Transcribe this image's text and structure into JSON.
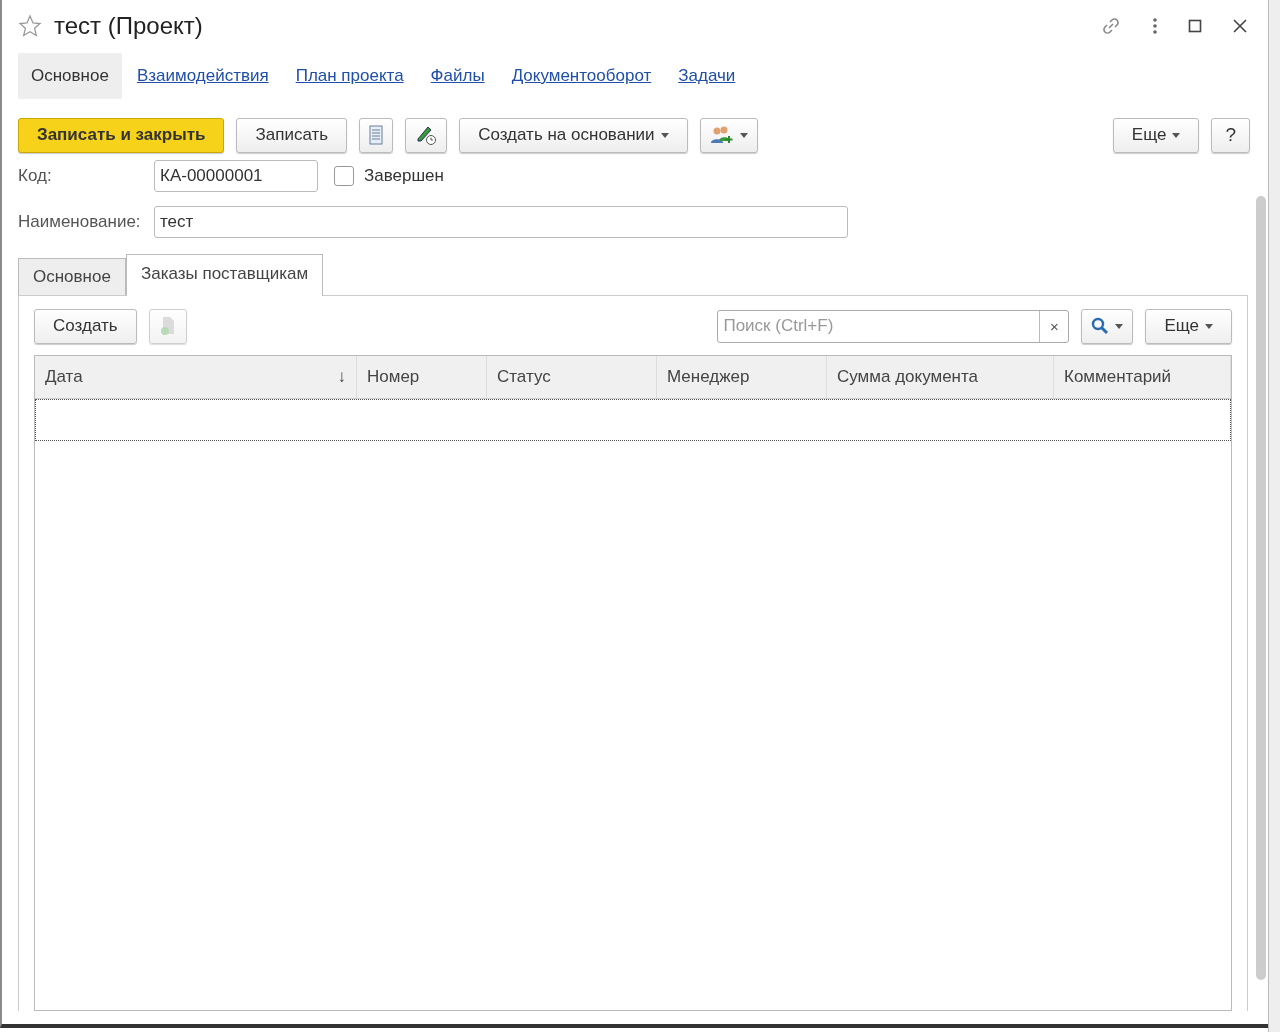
{
  "window": {
    "title": "тест (Проект)",
    "favorite": false
  },
  "nav_tabs": [
    {
      "label": "Основное",
      "selected": true
    },
    {
      "label": "Взаимодействия",
      "selected": false
    },
    {
      "label": "План проекта",
      "selected": false
    },
    {
      "label": "Файлы",
      "selected": false
    },
    {
      "label": "Документооборот",
      "selected": false
    },
    {
      "label": "Задачи",
      "selected": false
    }
  ],
  "toolbar": {
    "left": [
      {
        "kind": "primary",
        "label": "Записать и закрыть"
      },
      {
        "kind": "text",
        "label": "Записать"
      },
      {
        "kind": "list"
      },
      {
        "kind": "pen"
      },
      {
        "kind": "dropdown",
        "label": "Создать на основании"
      },
      {
        "kind": "users"
      }
    ],
    "more": "Еще",
    "help": "?"
  },
  "fields": {
    "code_label": "Код:",
    "code_value": "КА-00000001",
    "completed": {
      "label": "Завершен",
      "checked": false
    },
    "name_label": "Наименование:",
    "name_value": "тест"
  },
  "form_tabs": [
    {
      "label": "Основное",
      "selected": false
    },
    {
      "label": "Заказы поставщикам",
      "selected": true
    }
  ],
  "list_toolbar": {
    "create": "Создать",
    "search_placeholder": "Поиск (Ctrl+F)",
    "clear": "×",
    "more": "Еще"
  },
  "table": {
    "columns": [
      {
        "label": "Дата",
        "sort": "↓"
      },
      {
        "label": "Номер"
      },
      {
        "label": "Статус"
      },
      {
        "label": "Менеджер"
      },
      {
        "label": "Сумма документа"
      },
      {
        "label": "Комментарий"
      }
    ]
  }
}
